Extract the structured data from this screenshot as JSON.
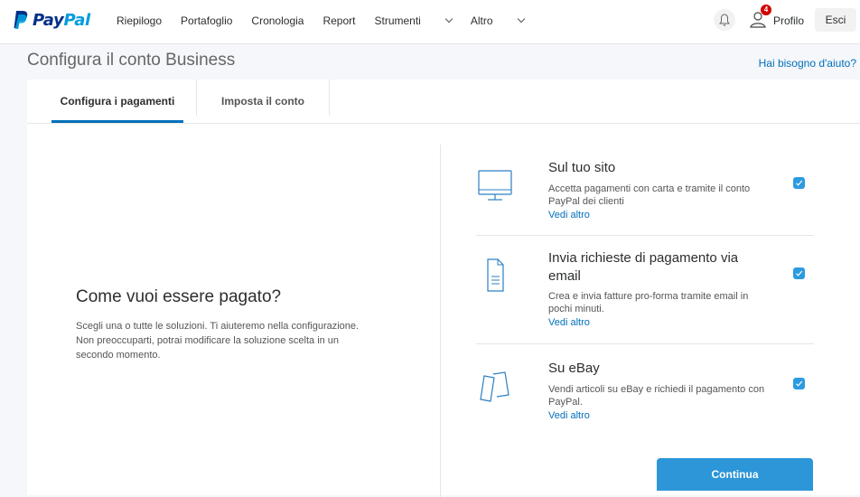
{
  "brand": {
    "pay": "Pay",
    "pal": "Pal"
  },
  "nav": {
    "items": [
      "Riepilogo",
      "Portafoglio",
      "Cronologia",
      "Report"
    ],
    "tools": "Strumenti",
    "more": "Altro",
    "notification_count": "4",
    "profile": "Profilo",
    "logout": "Esci"
  },
  "page": {
    "title": "Configura il conto Business",
    "help": "Hai bisogno d'aiuto?"
  },
  "tabs": [
    "Configura i pagamenti",
    "Imposta il conto"
  ],
  "intro": {
    "title": "Come vuoi essere pagato?",
    "description": "Scegli una o tutte le soluzioni. Ti aiuteremo nella configurazione. Non preoccuparti, potrai modificare la soluzione scelta in un secondo momento."
  },
  "options": [
    {
      "title": "Sul tuo sito",
      "description": "Accetta pagamenti con carta e tramite il conto PayPal dei clienti",
      "link": "Vedi altro",
      "checked": true,
      "icon": "monitor-icon"
    },
    {
      "title": "Invia richieste di pagamento via email",
      "description": "Crea e invia fatture pro-forma tramite email in pochi minuti.",
      "link": "Vedi altro",
      "checked": true,
      "icon": "invoice-icon"
    },
    {
      "title": "Su eBay",
      "description": "Vendi articoli su eBay e richiedi il pagamento con PayPal.",
      "link": "Vedi altro",
      "checked": true,
      "icon": "cards-icon"
    }
  ],
  "continue_label": "Continua",
  "colors": {
    "accent": "#0070ba",
    "brand_dark": "#003087",
    "brand_light": "#009cde",
    "checkbox": "#2d9bdf",
    "button": "#2d96d8"
  }
}
